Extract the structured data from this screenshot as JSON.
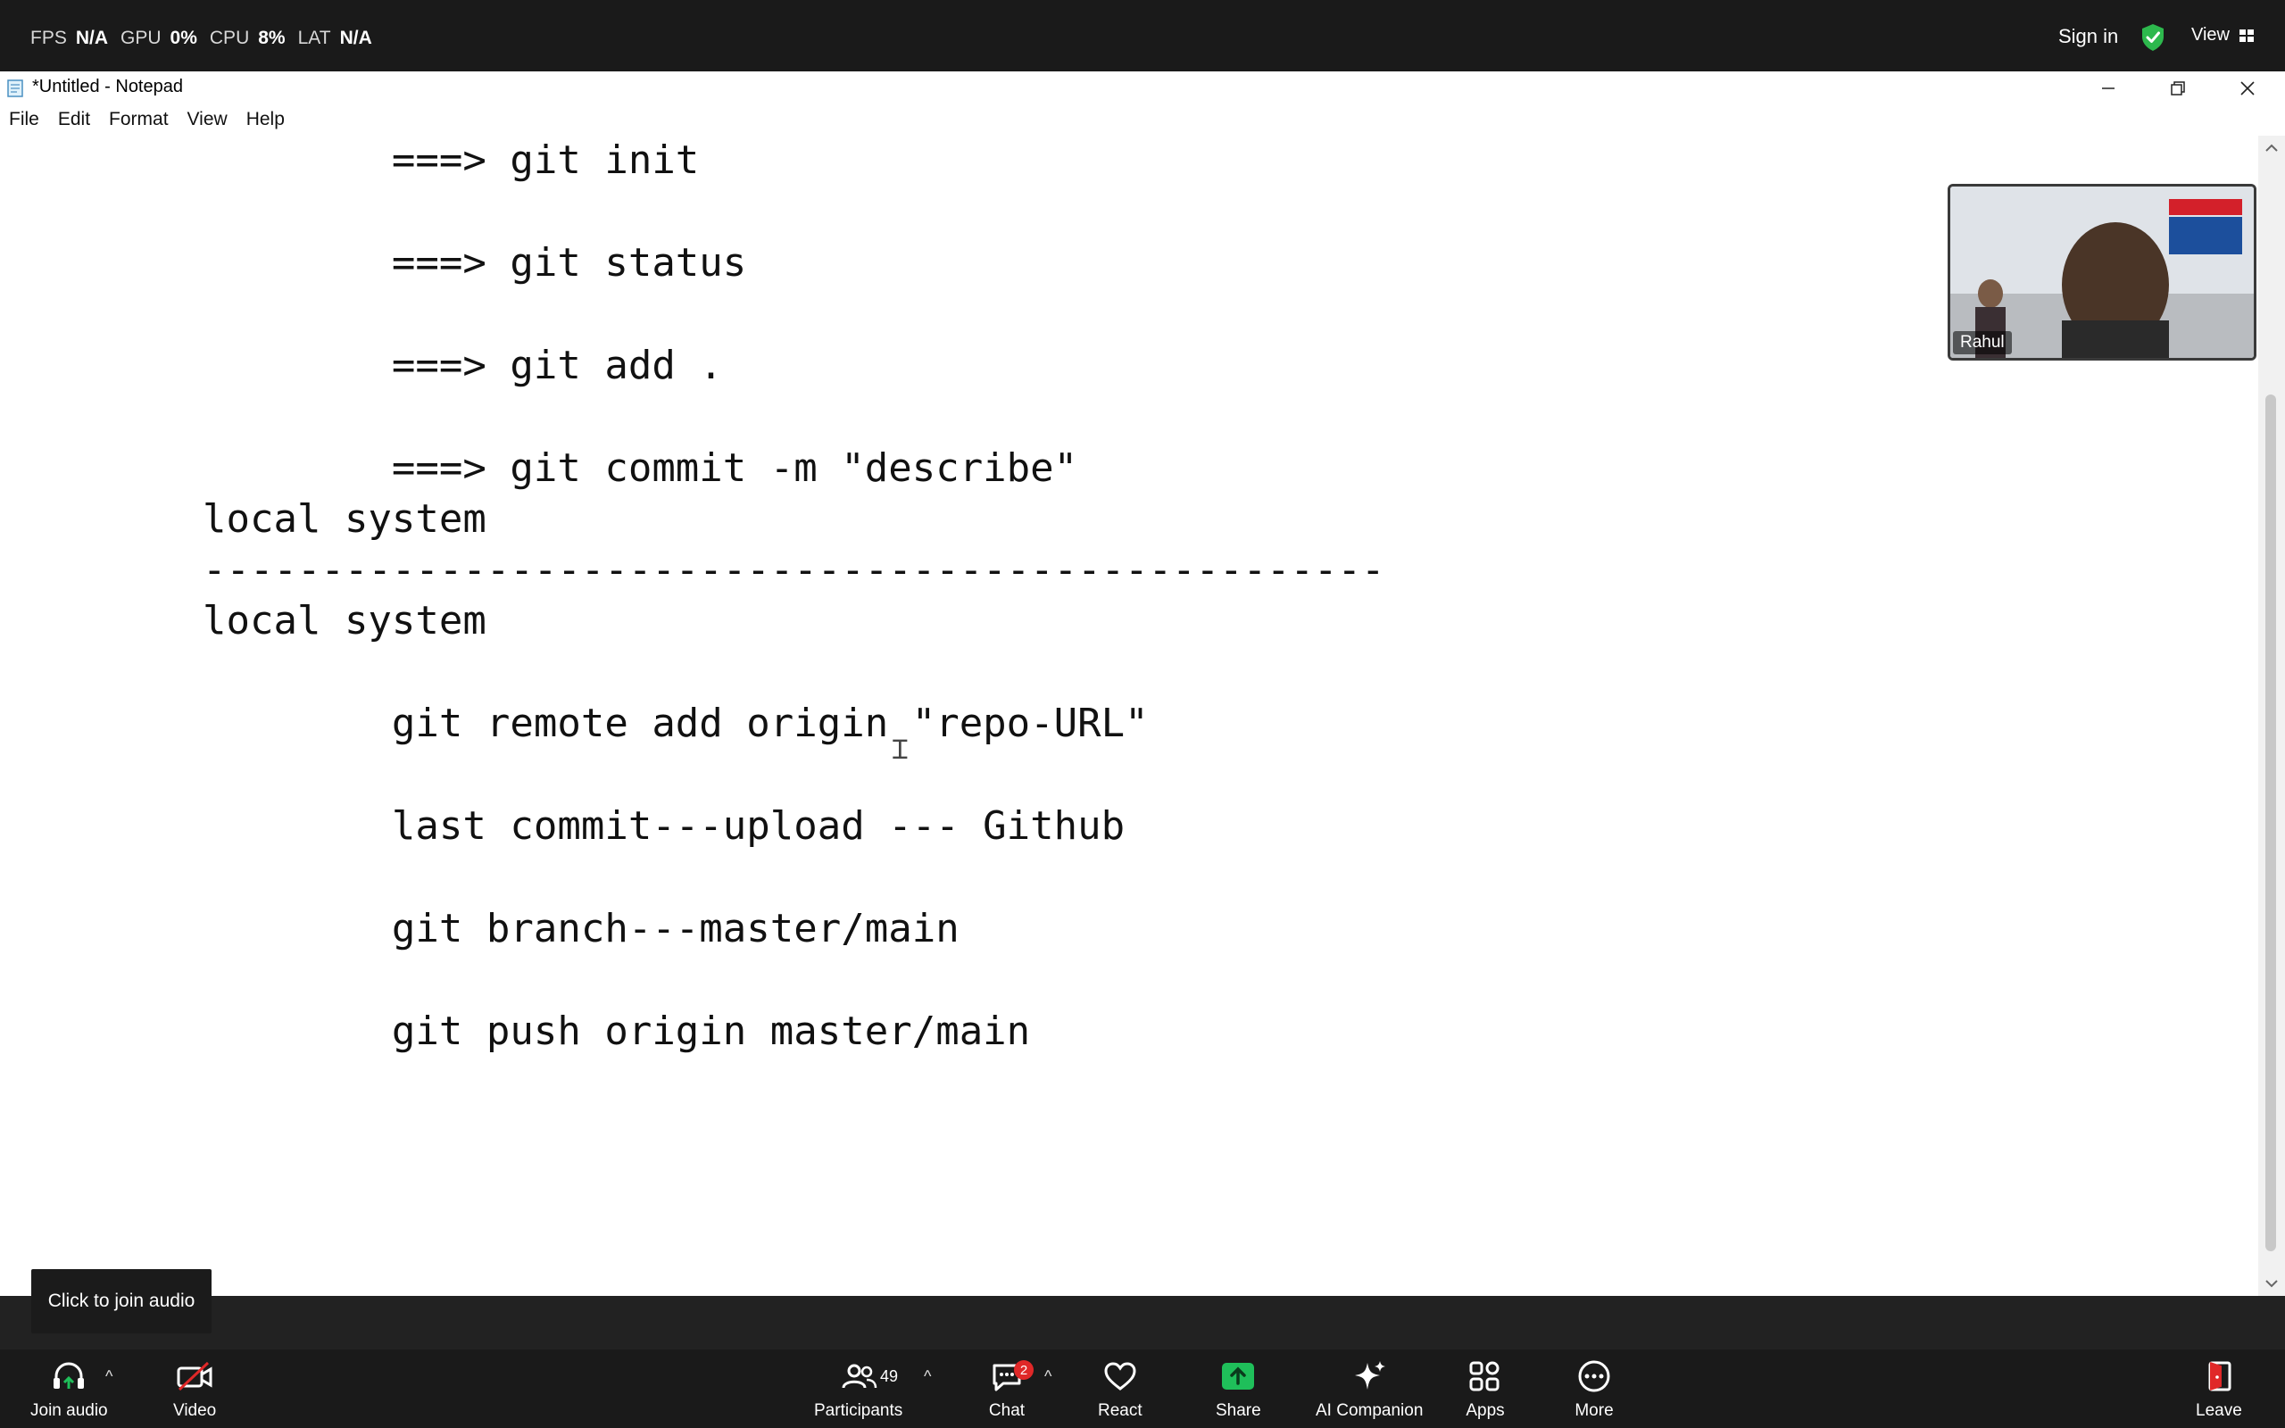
{
  "zoom_top": {
    "stats": [
      {
        "label": "FPS",
        "value": "N/A"
      },
      {
        "label": "GPU",
        "value": "0%"
      },
      {
        "label": "CPU",
        "value": "8%"
      },
      {
        "label": "LAT",
        "value": "N/A"
      }
    ],
    "sign_in": "Sign in",
    "view": "View"
  },
  "notepad": {
    "title": "*Untitled - Notepad",
    "menu": [
      "File",
      "Edit",
      "Format",
      "View",
      "Help"
    ],
    "lines": [
      "        ===> git init",
      "        ===> git status",
      "        ===> git add .",
      "        ===> git commit -m \"describe\"",
      "local system",
      "--------------------------------------------------",
      "local system",
      "        git remote add origin \"repo-URL\"",
      "        last commit---upload --- Github",
      "        git branch---master/main",
      "        git push origin master/main"
    ]
  },
  "video": {
    "participant_name": "Rahul"
  },
  "tooltip": "Click to join audio",
  "zoom_bottom": {
    "join_audio": "Join audio",
    "video": "Video",
    "participants": "Participants",
    "participants_count": "49",
    "chat": "Chat",
    "chat_badge": "2",
    "react": "React",
    "share": "Share",
    "ai_companion": "AI Companion",
    "apps": "Apps",
    "more": "More",
    "leave": "Leave"
  },
  "colors": {
    "zoom_bar": "#1a1a1a",
    "share_green": "#1fbf5a",
    "shield_green": "#2db84d",
    "badge_red": "#e02828",
    "leave_red": "#e02828"
  }
}
